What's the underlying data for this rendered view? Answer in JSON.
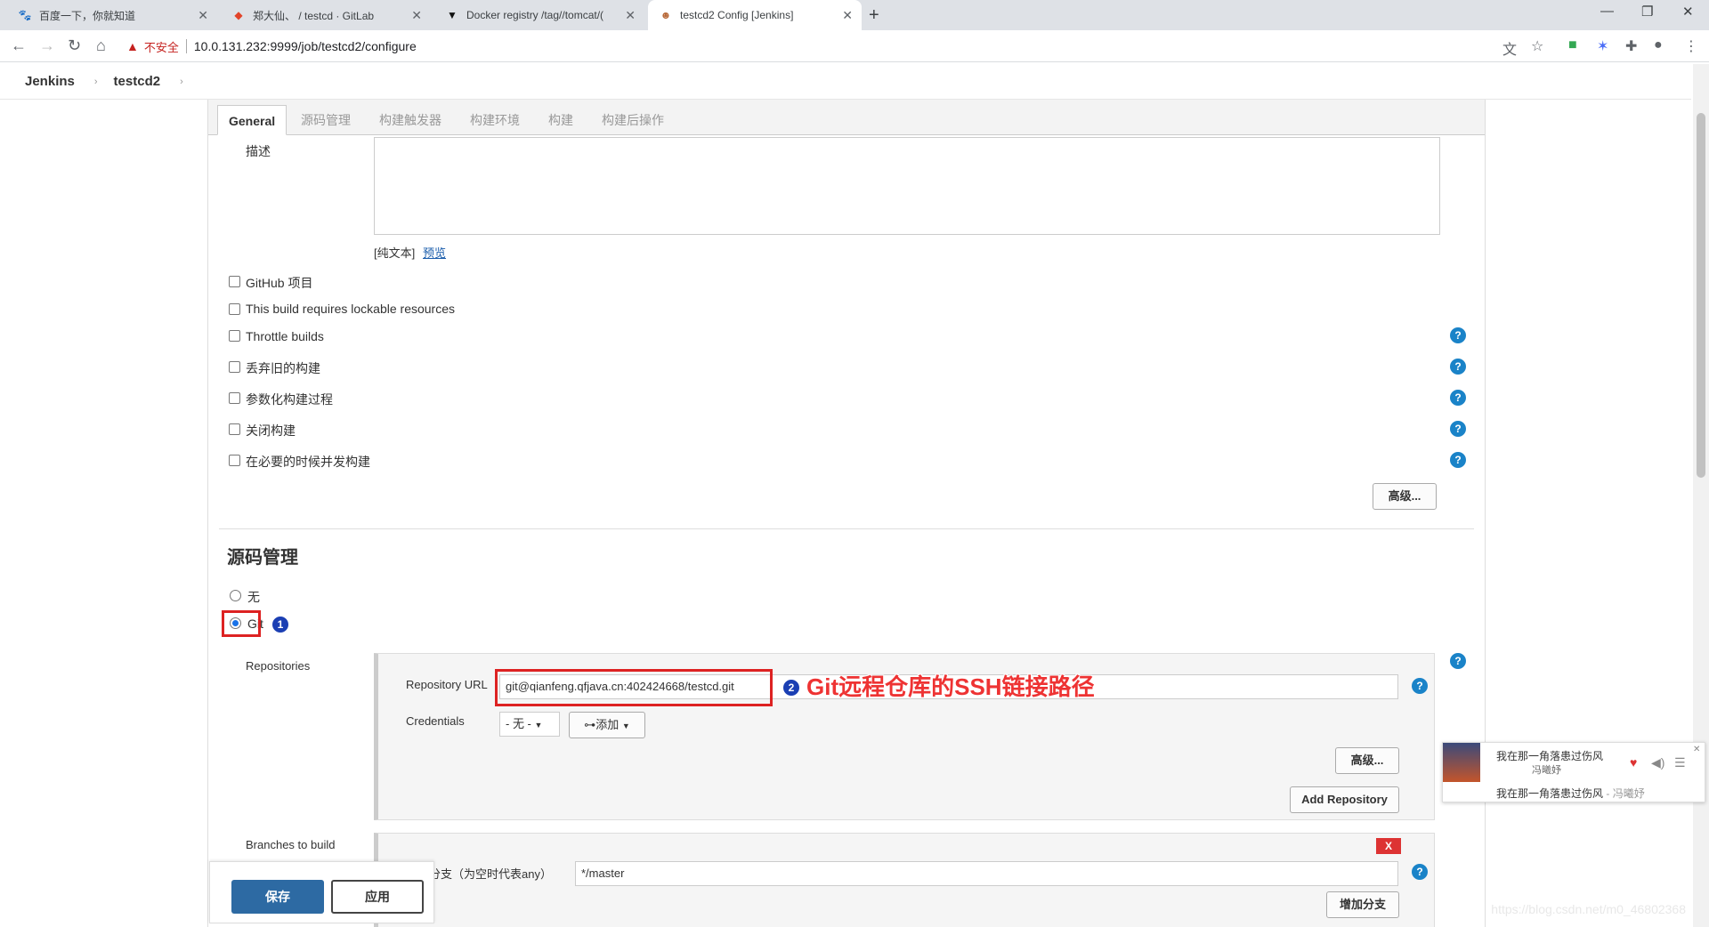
{
  "browser": {
    "tabs": [
      {
        "icon": "baidu-icon",
        "label": "百度一下，你就知道"
      },
      {
        "icon": "gitlab-icon",
        "label": "郑大仙、 / testcd · GitLab"
      },
      {
        "icon": "docker-icon",
        "label": "Docker registry /tag//tomcat/("
      },
      {
        "icon": "jenkins-icon",
        "label": "testcd2 Config [Jenkins]"
      }
    ],
    "url": "10.0.131.232:9999/job/testcd2/configure",
    "insecure_label": "不安全"
  },
  "breadcrumbs": [
    "Jenkins",
    "testcd2"
  ],
  "config_tabs": [
    "General",
    "源码管理",
    "构建触发器",
    "构建环境",
    "构建",
    "构建后操作"
  ],
  "general": {
    "description_label": "描述",
    "plain_text": "[纯文本]",
    "preview_link": "预览",
    "checkboxes": [
      "GitHub 项目",
      "This build requires lockable resources",
      "Throttle builds",
      "丢弃旧的构建",
      "参数化构建过程",
      "关闭构建",
      "在必要的时候并发构建"
    ],
    "advanced_button": "高级..."
  },
  "scm": {
    "title": "源码管理",
    "option_none": "无",
    "option_git": "Git",
    "repositories_label": "Repositories",
    "repo_url_label": "Repository URL",
    "repo_url_value": "git@qianfeng.qfjava.cn:402424668/testcd.git",
    "credentials_label": "Credentials",
    "credentials_value": "- 无 -",
    "add_button": "添加",
    "advanced_button": "高级...",
    "add_repository_button": "Add Repository",
    "branches_label": "Branches to build",
    "branch_specifier_label": "指定分支（为空时代表any）",
    "branch_value": "*/master",
    "add_branch_button": "增加分支",
    "delete_label": "X"
  },
  "annotations": {
    "step1": "1",
    "step2": "2",
    "callout": "Git远程仓库的SSH链接路径"
  },
  "actions": {
    "save": "保存",
    "apply": "应用"
  },
  "music_widget": {
    "song": "我在那一角落患过伤风",
    "artist": "冯曦妤",
    "line2_song": "我在那一角落患过伤风",
    "line2_artist": "- 冯曦妤"
  },
  "watermark": "https://blog.csdn.net/m0_46802368",
  "colors": {
    "help_blue": "#1a83c8",
    "save_blue": "#2d6aa3",
    "annotation_red": "#e33333"
  }
}
